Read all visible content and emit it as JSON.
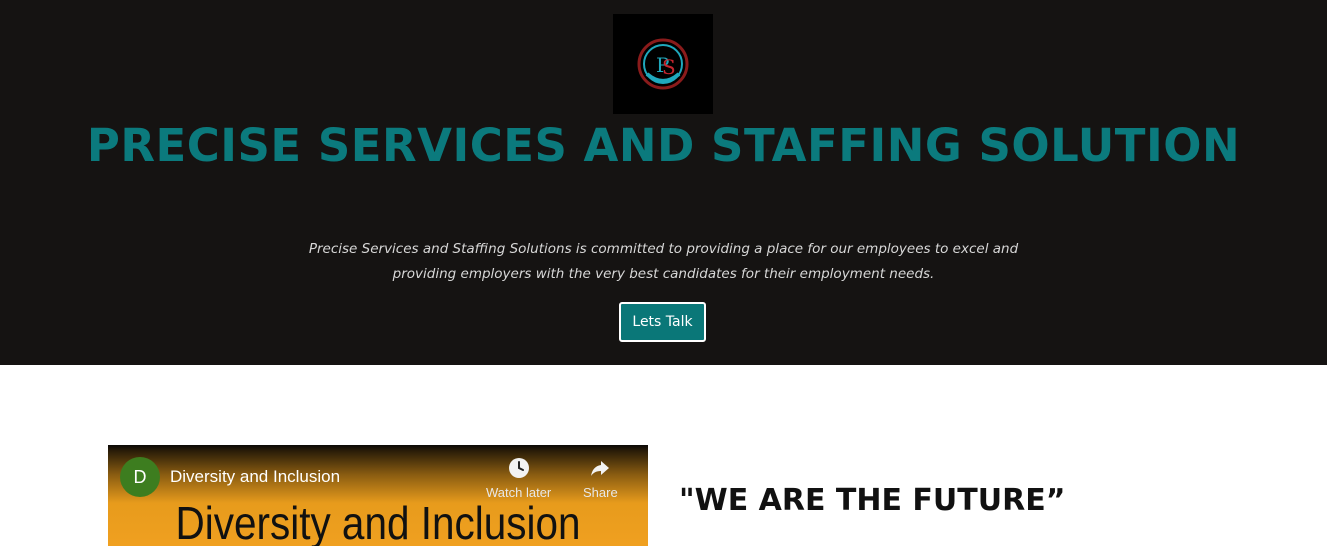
{
  "hero": {
    "logo_icon": "precise-services-logo",
    "title": "PRECISE SERVICES AND STAFFING SOLUTION",
    "subtitle": "Precise Services and Staffing Solutions is committed to providing a place for our employees to excel and providing employers with the very best candidates for their employment needs.",
    "cta_label": "Lets Talk"
  },
  "video": {
    "channel_initial": "D",
    "title": "Diversity and Inclusion",
    "watch_later_label": "Watch later",
    "share_label": "Share",
    "banner_text": "Diversity and Inclusion"
  },
  "quote": {
    "text": "\"WE ARE THE FUTURE”"
  },
  "colors": {
    "hero_bg": "#151312",
    "accent_teal": "#0b7a7d",
    "button_bg": "#0a7778",
    "video_orange": "#f0a020",
    "avatar_green": "#3d7d1f"
  }
}
